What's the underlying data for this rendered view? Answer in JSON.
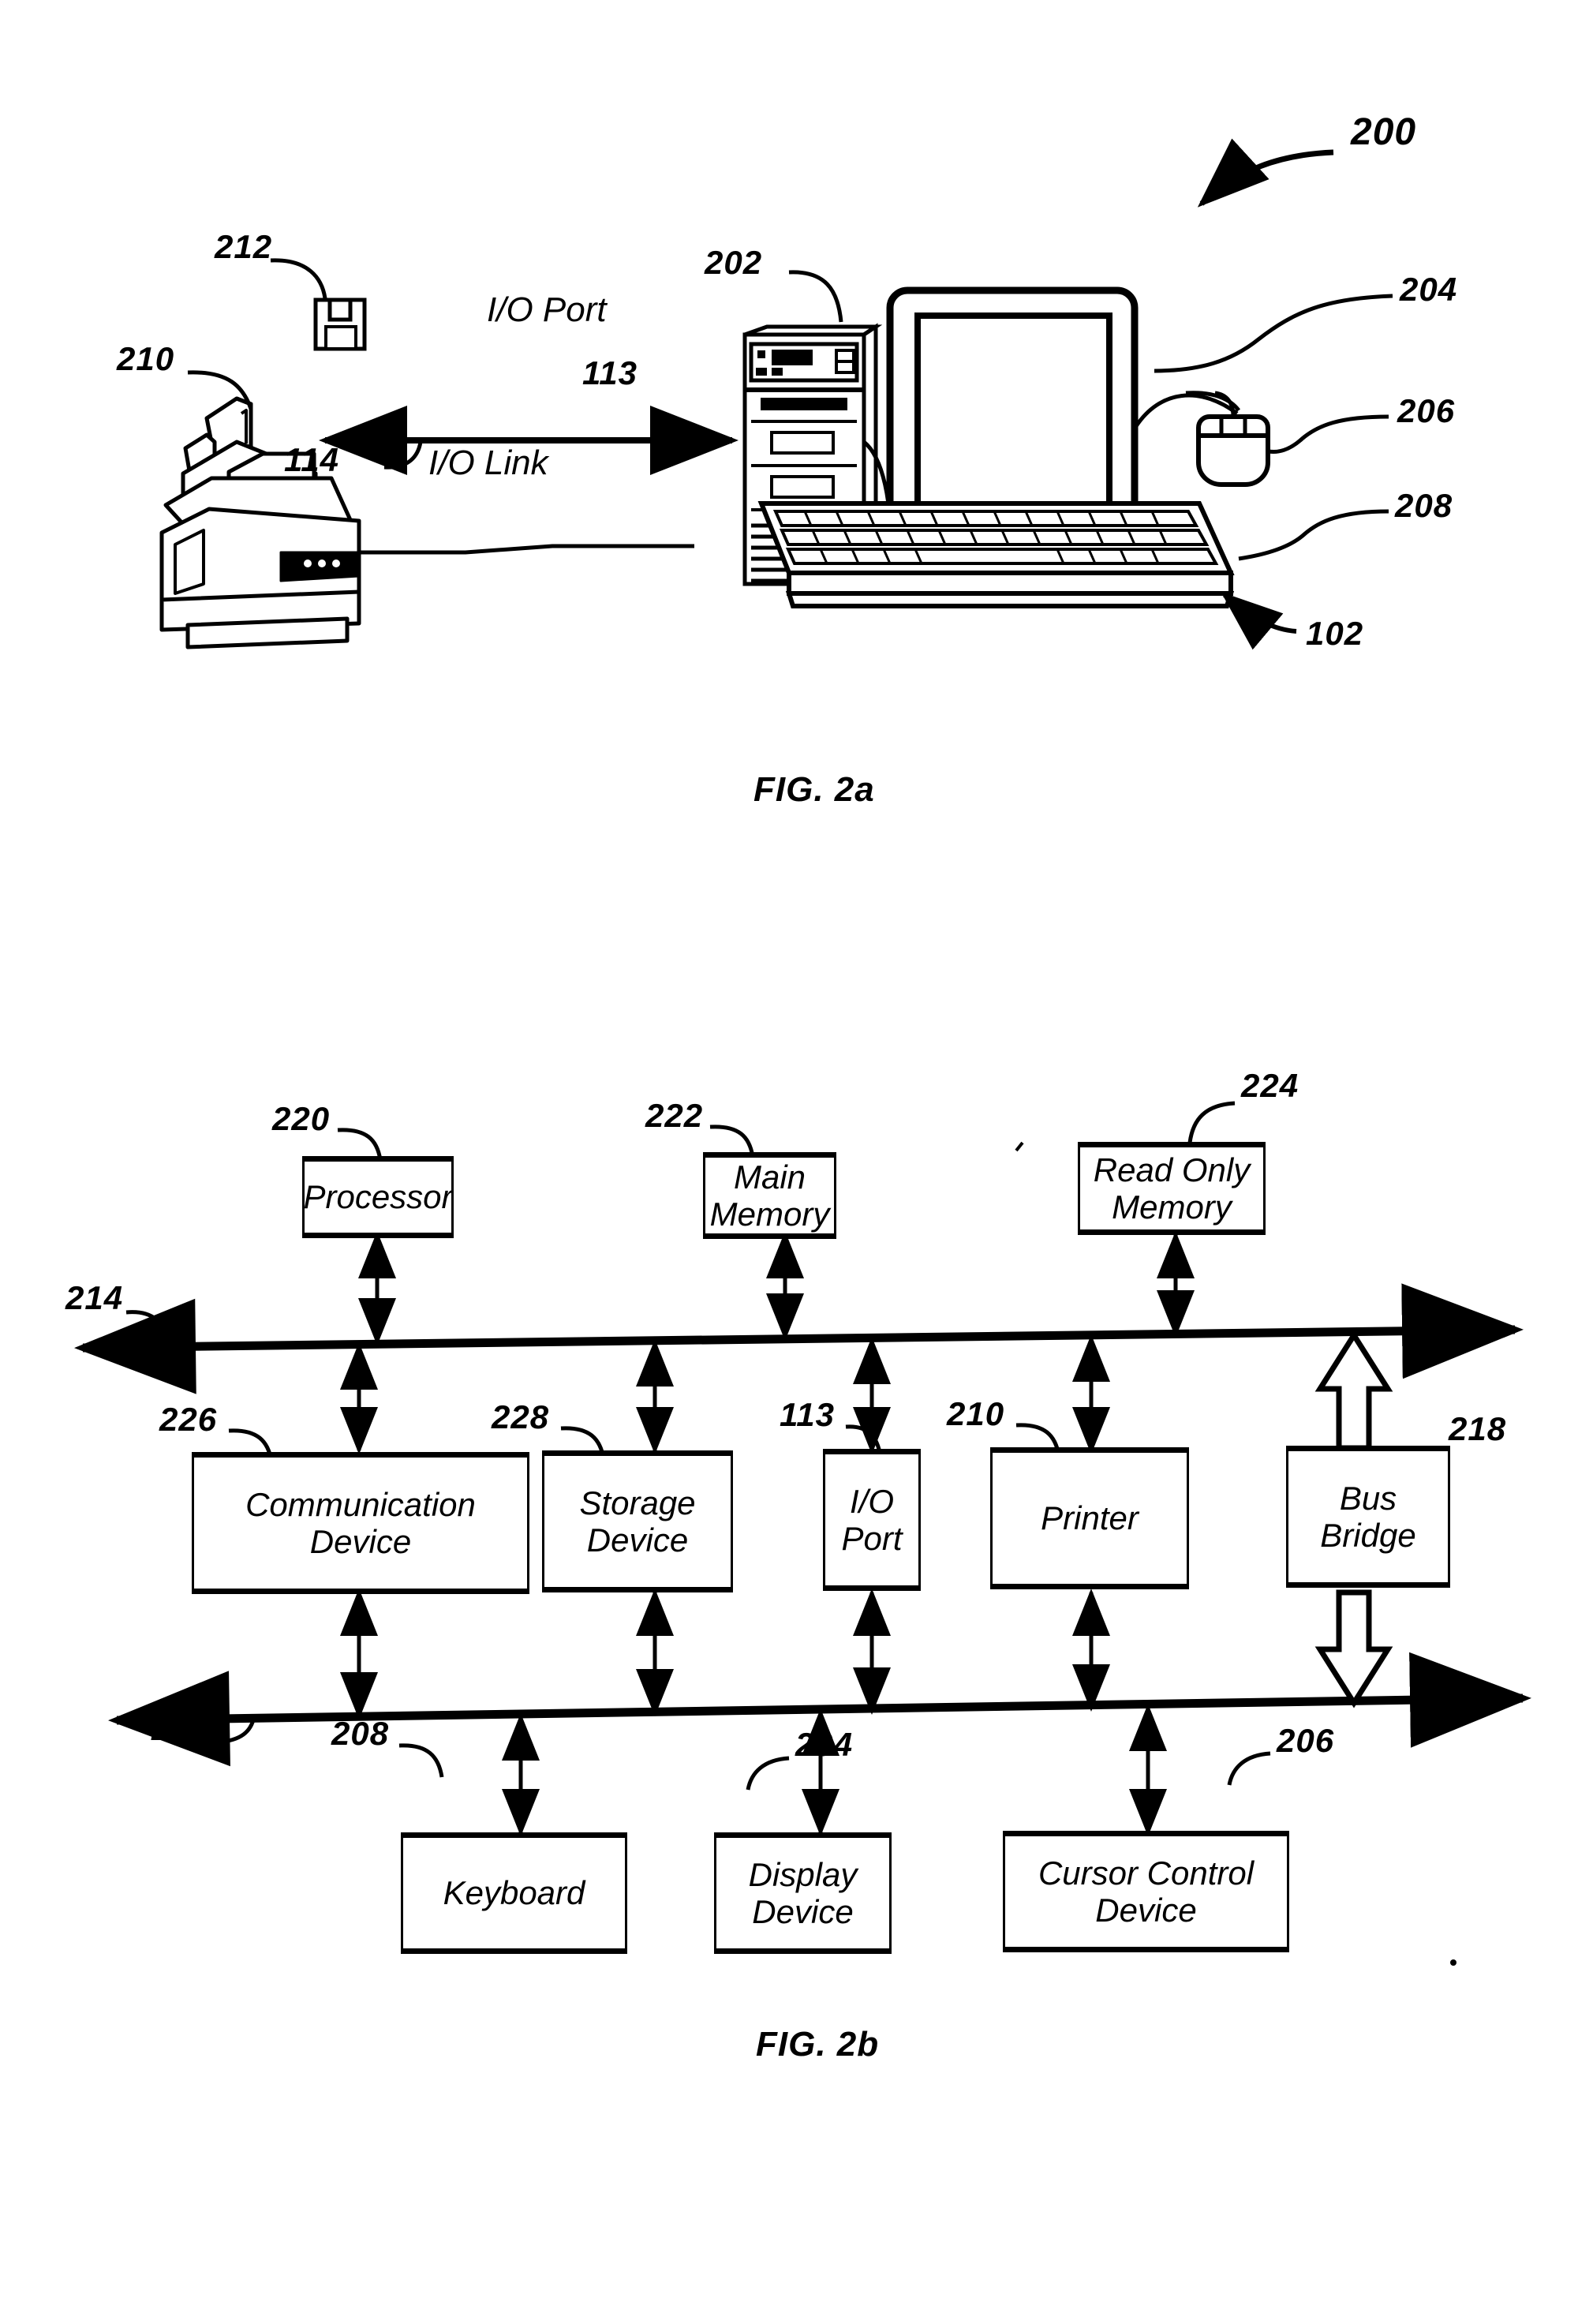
{
  "figure_set": {
    "overall_ref": "200"
  },
  "fig2a": {
    "caption": "FIG. 2a",
    "annotations": {
      "io_port_label": "I/O Port",
      "io_port_ref": "113",
      "io_link_label": "I/O Link",
      "io_link_ref": "114"
    },
    "refs": {
      "floppy_disk": "212",
      "printer": "210",
      "system_unit": "202",
      "display": "204",
      "mouse": "206",
      "keyboard": "208",
      "computer_system": "102"
    },
    "parts": [
      {
        "name": "floppy-disk",
        "ref": "212"
      },
      {
        "name": "printer",
        "ref": "210"
      },
      {
        "name": "system-unit",
        "ref": "202"
      },
      {
        "name": "display-monitor",
        "ref": "204"
      },
      {
        "name": "mouse",
        "ref": "206"
      },
      {
        "name": "keyboard",
        "ref": "208"
      },
      {
        "name": "computer-system",
        "ref": "102"
      }
    ]
  },
  "fig2b": {
    "caption": "FIG. 2b",
    "buses": [
      {
        "ref": "214",
        "name": "primary-bus"
      },
      {
        "ref": "216",
        "name": "secondary-bus"
      }
    ],
    "top_row": [
      {
        "ref": "220",
        "lines": [
          "Processor"
        ]
      },
      {
        "ref": "222",
        "lines": [
          "Main",
          "Memory"
        ]
      },
      {
        "ref": "224",
        "lines": [
          "Read Only",
          "Memory"
        ]
      }
    ],
    "middle_row": [
      {
        "ref": "226",
        "lines": [
          "Communication",
          "Device"
        ]
      },
      {
        "ref": "228",
        "lines": [
          "Storage",
          "Device"
        ]
      },
      {
        "ref": "113",
        "lines": [
          "I/O",
          "Port"
        ]
      },
      {
        "ref": "210",
        "lines": [
          "Printer"
        ]
      },
      {
        "ref": "218",
        "lines": [
          "Bus",
          "Bridge"
        ]
      }
    ],
    "bottom_row": [
      {
        "ref": "208",
        "lines": [
          "Keyboard"
        ]
      },
      {
        "ref": "204",
        "lines": [
          "Display",
          "Device"
        ]
      },
      {
        "ref": "206",
        "lines": [
          "Cursor Control",
          "Device"
        ]
      }
    ]
  },
  "colors": {
    "ink": "#000000",
    "paper": "#ffffff"
  }
}
